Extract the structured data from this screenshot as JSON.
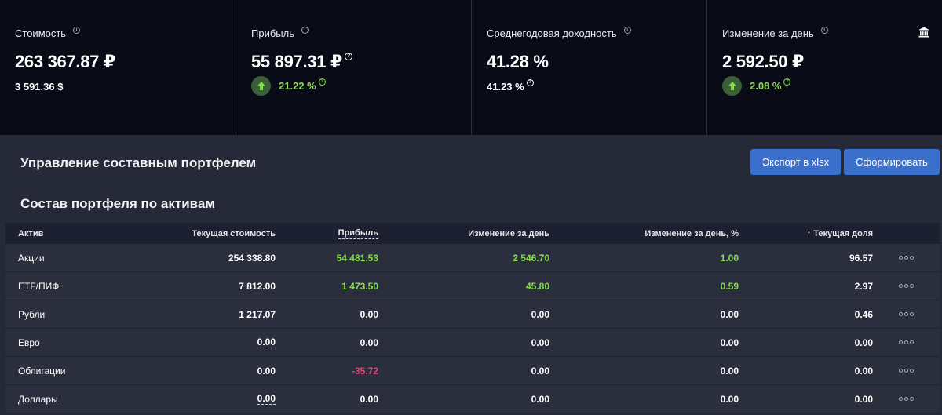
{
  "stats": [
    {
      "label": "Стоимость",
      "value": "263 367.87 ₽",
      "sub": "3 591.36 $"
    },
    {
      "label": "Прибыль",
      "value": "55 897.31 ₽",
      "change": "21.22 %"
    },
    {
      "label": "Среднегодовая доходность",
      "value": "41.28 %",
      "sub": "41.23 %"
    },
    {
      "label": "Изменение за день",
      "value": "2 592.50 ₽",
      "change": "2.08 %"
    }
  ],
  "section": {
    "title": "Управление составным портфелем",
    "export_label": "Экспорт в xlsx",
    "form_label": "Сформировать",
    "subtitle": "Состав портфеля по активам"
  },
  "table": {
    "headers": {
      "asset": "Актив",
      "value": "Текущая стоимость",
      "profit": "Прибыль",
      "change": "Изменение за день",
      "change_pct": "Изменение за день, %",
      "share": "↑ Текущая доля"
    },
    "rows": [
      {
        "asset": "Акции",
        "value": "254 338.80",
        "profit": "54 481.53",
        "change": "2 546.70",
        "change_pct": "1.00",
        "share": "96.57"
      },
      {
        "asset": "ETF/ПИФ",
        "value": "7 812.00",
        "profit": "1 473.50",
        "change": "45.80",
        "change_pct": "0.59",
        "share": "2.97"
      },
      {
        "asset": "Рубли",
        "value": "1 217.07",
        "profit": "0.00",
        "change": "0.00",
        "change_pct": "0.00",
        "share": "0.46"
      },
      {
        "asset": "Евро",
        "value": "0.00",
        "profit": "0.00",
        "change": "0.00",
        "change_pct": "0.00",
        "share": "0.00"
      },
      {
        "asset": "Облигации",
        "value": "0.00",
        "profit": "-35.72",
        "change": "0.00",
        "change_pct": "0.00",
        "share": "0.00"
      },
      {
        "asset": "Доллары",
        "value": "0.00",
        "profit": "0.00",
        "change": "0.00",
        "change_pct": "0.00",
        "share": "0.00"
      }
    ]
  },
  "icons": {
    "info": "info-icon",
    "question": "question-icon",
    "up_arrow": "arrow-up-icon",
    "bank": "bank-icon",
    "more": "more-dots-icon"
  },
  "colors": {
    "positive": "#85dd4a",
    "negative": "#e0456e",
    "button": "#3b6fcc"
  }
}
